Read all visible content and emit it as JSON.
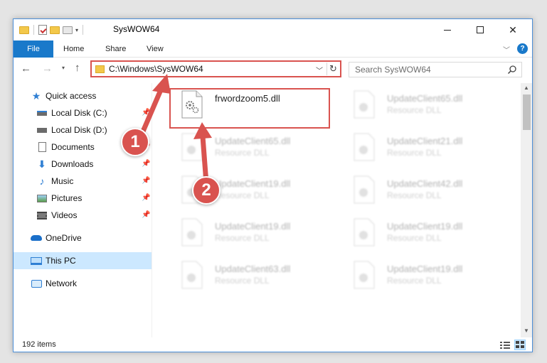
{
  "window": {
    "title": "SysWOW64"
  },
  "ribbon": {
    "file_label": "File",
    "home_label": "Home",
    "share_label": "Share",
    "view_label": "View",
    "help_glyph": "?"
  },
  "nav": {
    "address": "C:\\Windows\\SysWOW64",
    "search_placeholder": "Search SysWOW64"
  },
  "sidebar": {
    "items": [
      {
        "label": "Quick access",
        "icon": "star-icon",
        "pinned": false
      },
      {
        "label": "Local Disk (C:)",
        "icon": "drive-icon",
        "pinned": true
      },
      {
        "label": "Local Disk (D:)",
        "icon": "drive-icon",
        "pinned": false
      },
      {
        "label": "Documents",
        "icon": "documents-icon",
        "pinned": true
      },
      {
        "label": "Downloads",
        "icon": "download-icon",
        "pinned": true
      },
      {
        "label": "Music",
        "icon": "music-icon",
        "pinned": true
      },
      {
        "label": "Pictures",
        "icon": "pictures-icon",
        "pinned": true
      },
      {
        "label": "Videos",
        "icon": "videos-icon",
        "pinned": true
      },
      {
        "label": "OneDrive",
        "icon": "cloud-icon",
        "pinned": false
      },
      {
        "label": "This PC",
        "icon": "computer-icon",
        "pinned": false,
        "selected": true
      },
      {
        "label": "Network",
        "icon": "network-icon",
        "pinned": false
      }
    ]
  },
  "files": [
    {
      "name": "frwordzoom5.dll",
      "type": ""
    },
    {
      "name": "UpdateClient65.dll",
      "type": "Resource DLL"
    },
    {
      "name": "UpdateClient65.dll",
      "type": "Resource DLL"
    },
    {
      "name": "UpdateClient21.dll",
      "type": "Resource DLL"
    },
    {
      "name": "UpdateClient19.dll",
      "type": "Resource DLL"
    },
    {
      "name": "UpdateClient42.dll",
      "type": "Resource DLL"
    },
    {
      "name": "UpdateClient19.dll",
      "type": "Resource DLL"
    },
    {
      "name": "UpdateClient19.dll",
      "type": "Resource DLL"
    },
    {
      "name": "UpdateClient63.dll",
      "type": "Resource DLL"
    },
    {
      "name": "UpdateClient19.dll",
      "type": "Resource DLL"
    }
  ],
  "status": {
    "item_count": "192 items"
  },
  "annotations": {
    "step1": "1",
    "step2": "2"
  },
  "colors": {
    "accent": "#1979ca",
    "annotation_red": "#d9534f",
    "selected_bg": "#cce8ff"
  }
}
